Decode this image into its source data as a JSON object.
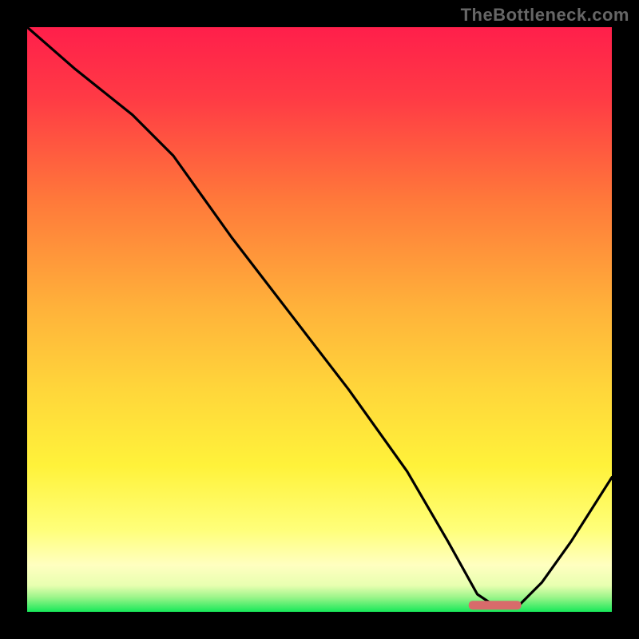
{
  "watermark": "TheBottleneck.com",
  "chart_data": {
    "type": "line",
    "title": "",
    "xlabel": "",
    "ylabel": "",
    "xlim": [
      0,
      100
    ],
    "ylim": [
      0,
      100
    ],
    "grid": false,
    "curve_note": "Bottleneck-style curve: a black line starting near top-left, sloping down with a slight knee around x≈25, continuing straight down to a minimum basin around x≈78–84, then rising back to ~y≈23 at the right edge. A small red lozenge marks the optimal basin.",
    "series": [
      {
        "name": "bottleneck-curve",
        "x": [
          0,
          8,
          18,
          25,
          35,
          45,
          55,
          65,
          72,
          77,
          80,
          84,
          88,
          93,
          100
        ],
        "y": [
          100,
          93,
          85,
          78,
          64,
          51,
          38,
          24,
          12,
          3,
          1,
          1,
          5,
          12,
          23
        ]
      }
    ],
    "marker": {
      "name": "optimal-range",
      "x_center": 80,
      "y": 1.2,
      "width": 9,
      "color": "#d86b6b"
    },
    "gradient_stops": [
      {
        "offset": 0.0,
        "color": "#ff1f4b"
      },
      {
        "offset": 0.12,
        "color": "#ff3a45"
      },
      {
        "offset": 0.3,
        "color": "#ff7a3a"
      },
      {
        "offset": 0.48,
        "color": "#ffb23a"
      },
      {
        "offset": 0.62,
        "color": "#ffd63a"
      },
      {
        "offset": 0.75,
        "color": "#fff23a"
      },
      {
        "offset": 0.86,
        "color": "#ffff7a"
      },
      {
        "offset": 0.92,
        "color": "#ffffc0"
      },
      {
        "offset": 0.955,
        "color": "#e8ffb0"
      },
      {
        "offset": 0.975,
        "color": "#9cf58a"
      },
      {
        "offset": 1.0,
        "color": "#17e859"
      }
    ]
  }
}
